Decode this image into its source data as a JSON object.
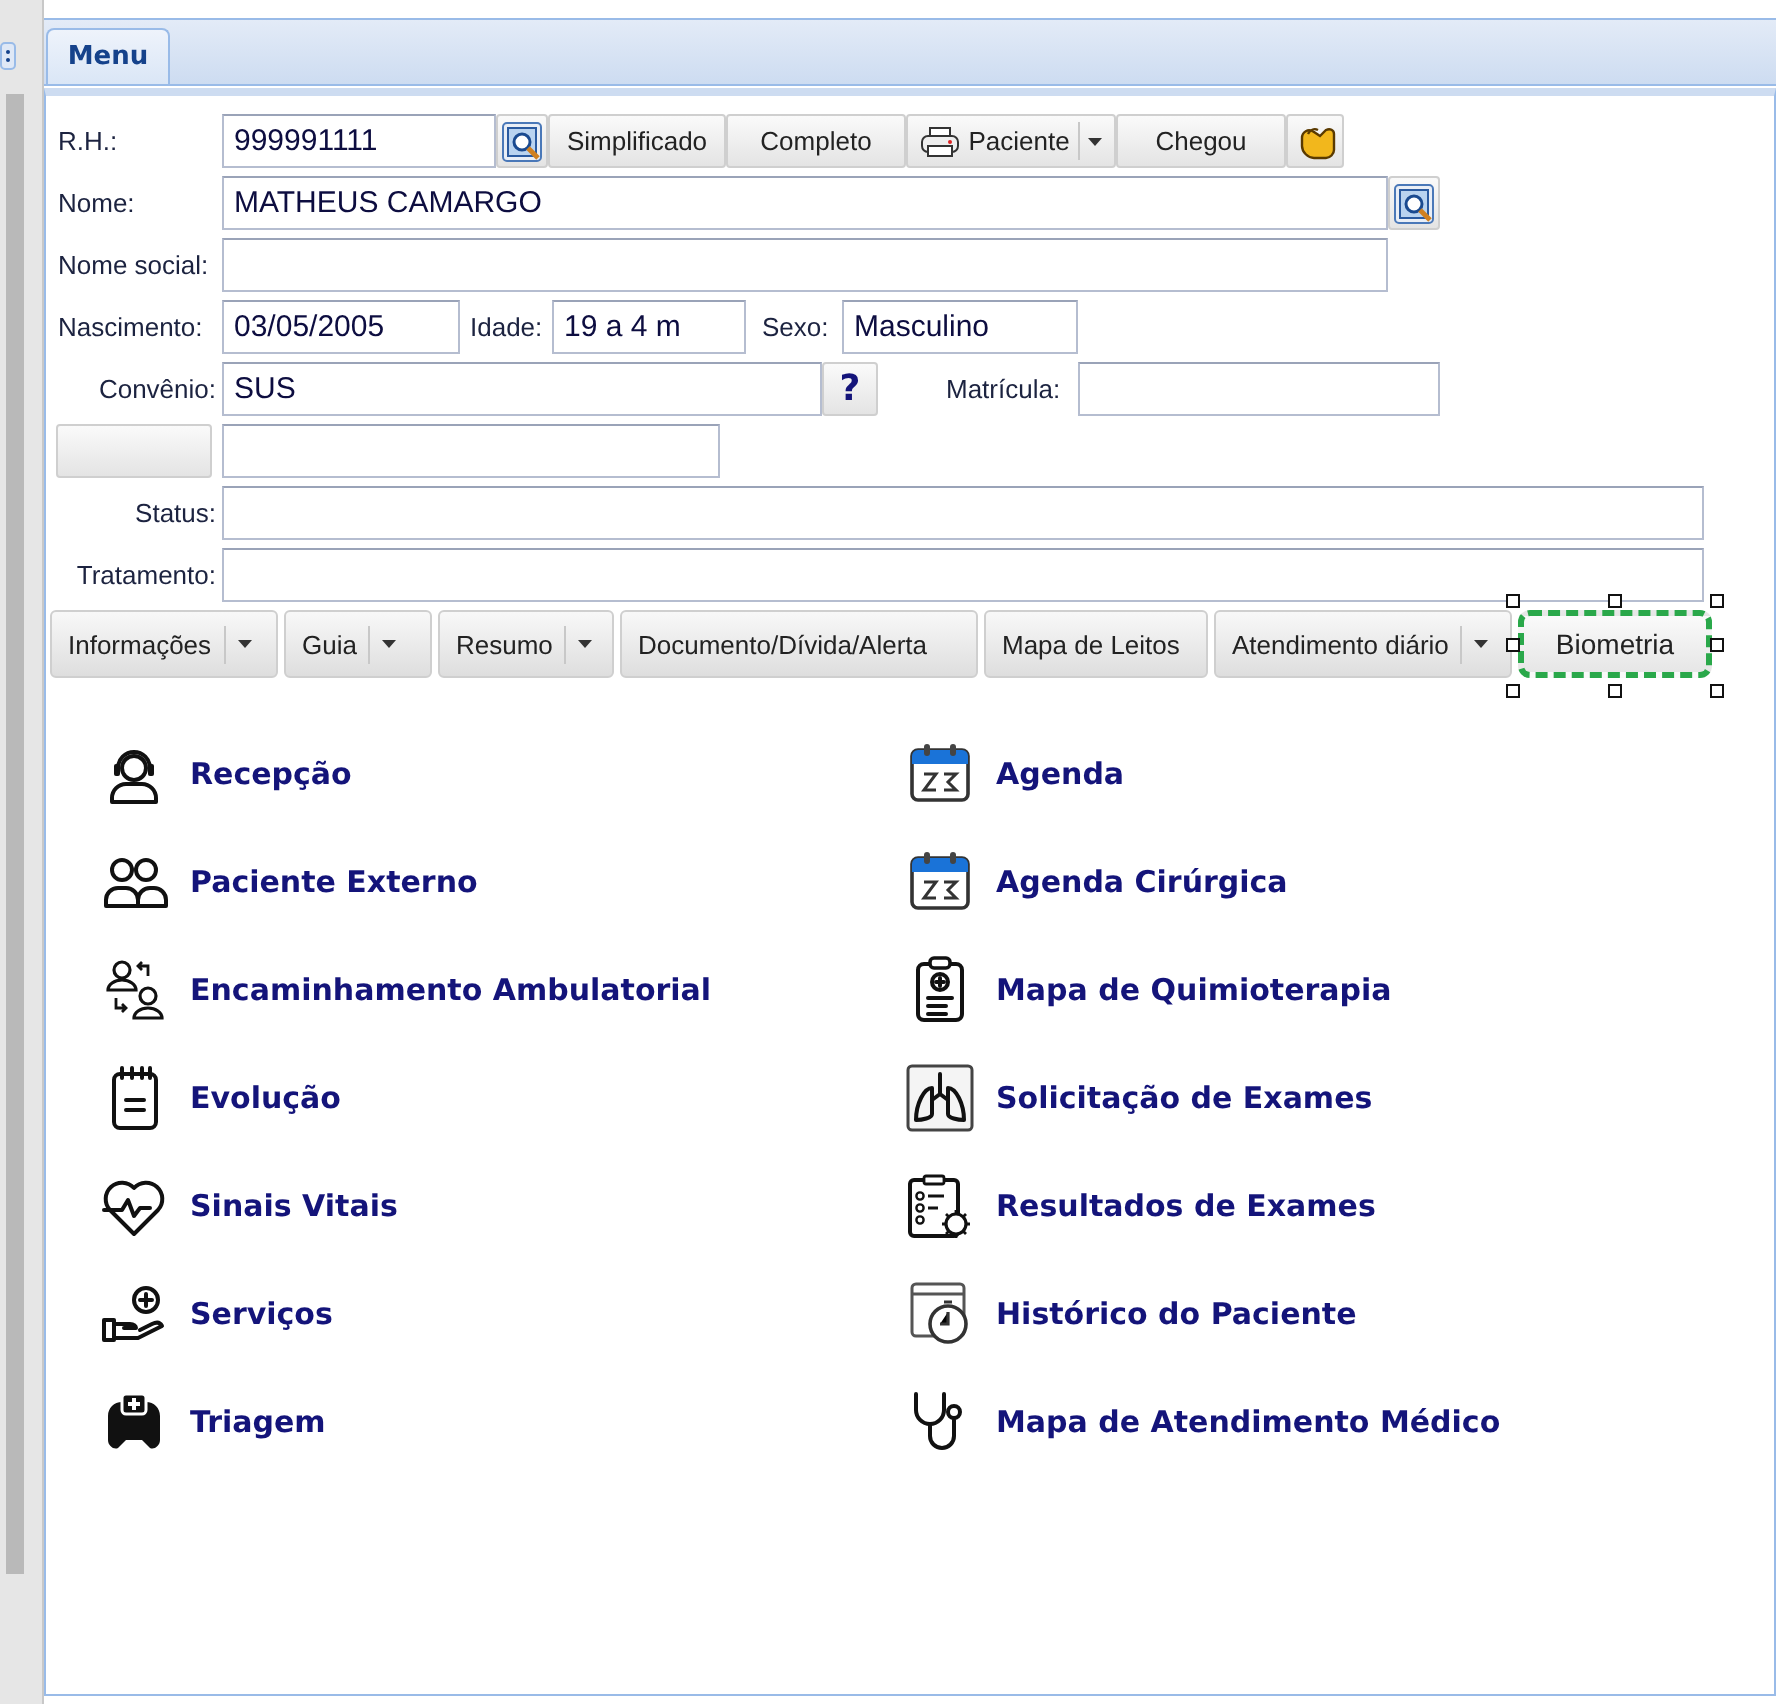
{
  "tab": {
    "label": "Menu",
    "selected": true
  },
  "form": {
    "rows": [
      [
        {
          "kind": "label",
          "text": "R.H.:"
        },
        {
          "kind": "field",
          "value": "999991111"
        },
        {
          "kind": "icon"
        },
        {
          "kind": "button",
          "label": "Simplificado"
        },
        {
          "kind": "button",
          "label": "Completo"
        },
        {
          "kind": "split",
          "label": "Paciente"
        },
        {
          "kind": "button",
          "label": "Chegou"
        },
        {
          "kind": "icon"
        }
      ],
      [
        {
          "kind": "label",
          "text": "Nome:"
        },
        {
          "kind": "field",
          "value": "MATHEUS CAMARGO"
        },
        {
          "kind": "icon"
        }
      ],
      [
        {
          "kind": "label",
          "text": "Nome social:"
        },
        {
          "kind": "field"
        }
      ],
      [
        {
          "kind": "label",
          "text": "Nascimento:"
        },
        {
          "kind": "field",
          "value": "03/05/2005"
        },
        {
          "kind": "label",
          "text": "Idade:"
        },
        {
          "kind": "field",
          "value": "19 a 4 m"
        },
        {
          "kind": "label",
          "text": "Sexo:"
        },
        {
          "kind": "field",
          "value": "Masculino"
        }
      ],
      [
        {
          "kind": "label",
          "text": "Convênio:"
        },
        {
          "kind": "field",
          "value": "SUS"
        },
        {
          "kind": "help",
          "label": "?"
        },
        {
          "kind": "label",
          "text": "Matrícula:"
        },
        {
          "kind": "field"
        }
      ],
      [
        {
          "kind": "blank"
        },
        {
          "kind": "field"
        }
      ],
      [
        {
          "kind": "label",
          "text": "Status:"
        },
        {
          "kind": "field"
        }
      ],
      [
        {
          "kind": "label",
          "text": "Tratamento:"
        },
        {
          "kind": "field"
        }
      ]
    ]
  },
  "toolbar": [
    {
      "label": "Informações",
      "dropdown": true,
      "selected": false
    },
    {
      "label": "Guia",
      "dropdown": true,
      "selected": false
    },
    {
      "label": "Resumo",
      "dropdown": true,
      "selected": false
    },
    {
      "label": "Documento/Dívida/Alerta",
      "dropdown": false,
      "selected": false
    },
    {
      "label": "Mapa de Leitos",
      "dropdown": false,
      "selected": false
    },
    {
      "label": "Atendimento diário",
      "dropdown": true,
      "selected": false
    },
    {
      "label": "Biometria",
      "dropdown": false,
      "selected": true
    }
  ],
  "menu": {
    "columns": [
      [
        {
          "label": "Recepção"
        },
        {
          "label": "Paciente Externo"
        },
        {
          "label": "Encaminhamento Ambulatorial"
        },
        {
          "label": "Evolução"
        },
        {
          "label": "Sinais Vitais"
        },
        {
          "label": "Serviços"
        },
        {
          "label": "Triagem"
        }
      ],
      [
        {
          "label": "Agenda"
        },
        {
          "label": "Agenda Cirúrgica"
        },
        {
          "label": "Mapa de Quimioterapia"
        },
        {
          "label": "Solicitação de Exames"
        },
        {
          "label": "Resultados de Exames"
        },
        {
          "label": "Histórico do Paciente"
        },
        {
          "label": "Mapa de Atendimento Médico"
        }
      ]
    ]
  }
}
